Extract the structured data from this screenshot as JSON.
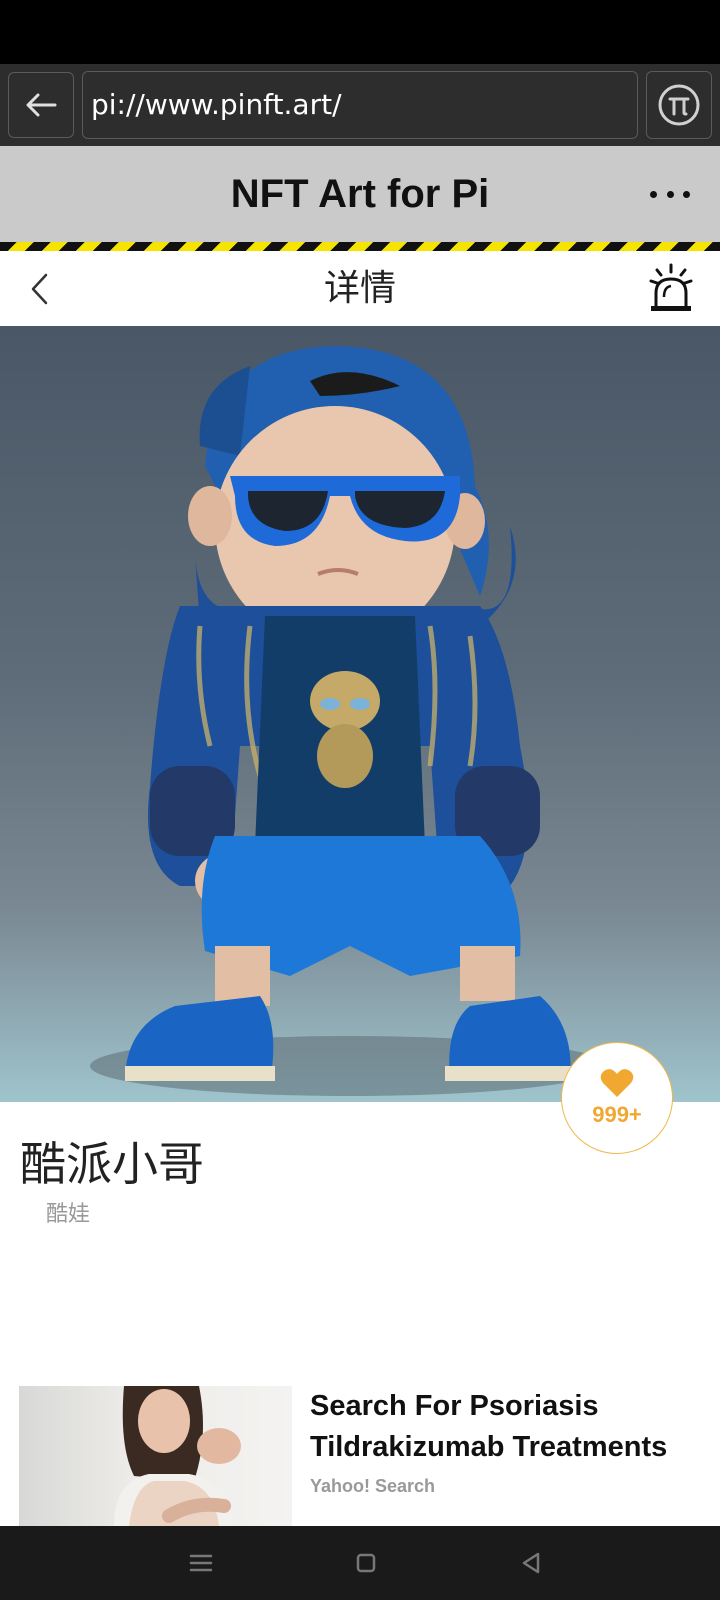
{
  "browser": {
    "url": "pi://www.pinft.art/",
    "back_icon": "arrow-left-icon",
    "pi_icon": "pi-logo-icon"
  },
  "app": {
    "title": "NFT Art for Pi",
    "more_icon": "more-dots-icon"
  },
  "page": {
    "title": "详情",
    "back_icon": "chevron-left-icon",
    "alarm_icon": "alarm-siren-icon"
  },
  "artwork": {
    "description_icon": "nft-artwork-image"
  },
  "nft": {
    "name": "酷派小哥",
    "category": "酷娃",
    "likes": "999+",
    "like_icon": "heart-icon"
  },
  "ad": {
    "title": "Search For Psoriasis Tildrakizumab Treatments",
    "source": "Yahoo! Search"
  },
  "colors": {
    "accent": "#f0a830",
    "hazard_yellow": "#f5e400",
    "app_bar": "#cacaca"
  }
}
